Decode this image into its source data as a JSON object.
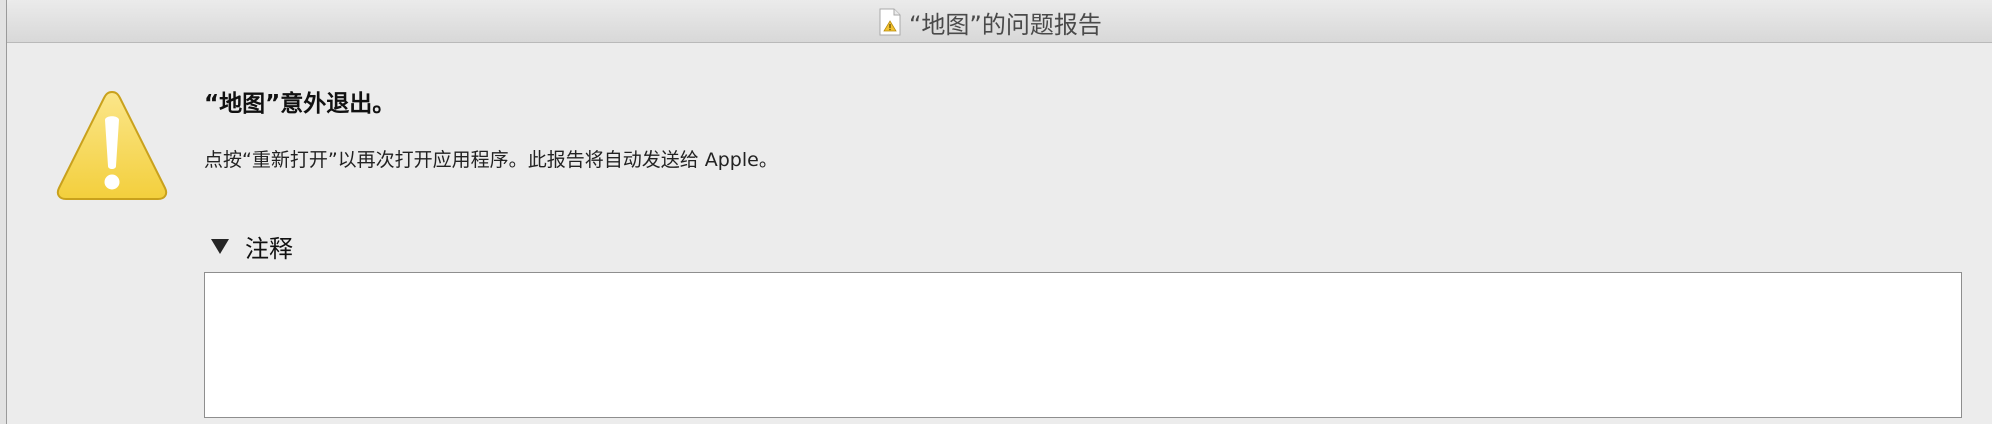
{
  "window": {
    "title": "“地图”的问题报告",
    "title_icon": "warning-document-icon"
  },
  "alert": {
    "icon": "warning-triangle-icon",
    "headline": "“地图”意外退出。",
    "message": "点按“重新打开”以再次打开应用程序。此报告将自动发送给 Apple。"
  },
  "comments_section": {
    "label": "注释",
    "expanded": true,
    "disclosure_icon": "disclosure-triangle-down-icon",
    "value": "",
    "placeholder": ""
  },
  "colors": {
    "warning_fill": "#f8d84a",
    "warning_mark": "#ffffff",
    "window_bg": "#ececec"
  }
}
